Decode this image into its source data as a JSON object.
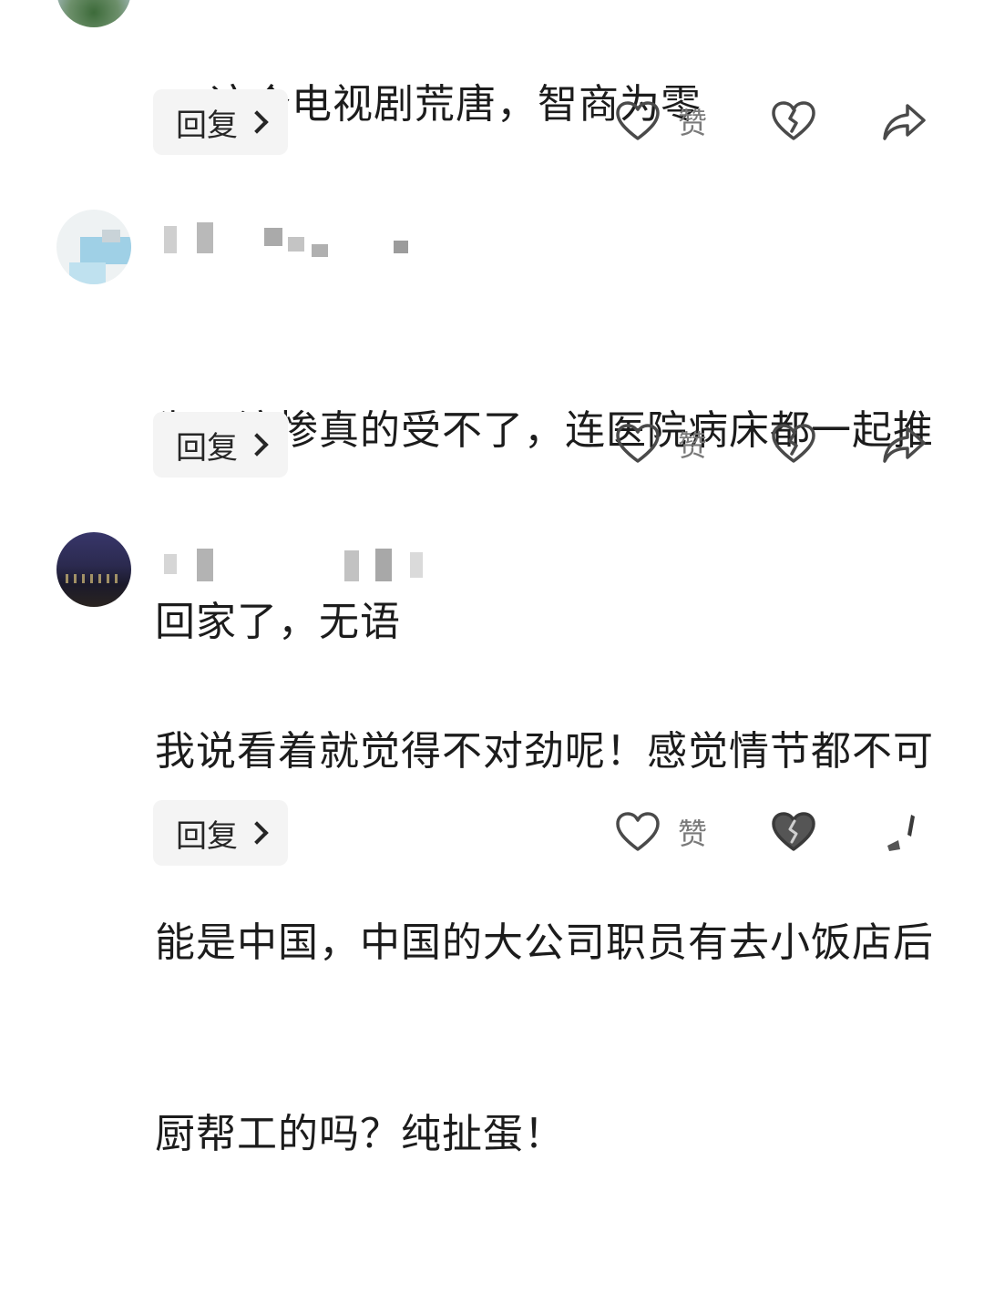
{
  "comments": [
    {
      "text_lines": [
        "这个电视剧荒唐，智商为零"
      ],
      "reply_label": "回复",
      "like_label": "赞"
    },
    {
      "text_lines": [
        "为了演惨真的受不了，连医院病床都一起推",
        "回家了，无语"
      ],
      "reply_label": "回复",
      "like_label": "赞"
    },
    {
      "text_lines": [
        "我说看着就觉得不对劲呢！感觉情节都不可",
        "能是中国，中国的大公司职员有去小饭店后",
        "厨帮工的吗？纯扯蛋！"
      ],
      "reply_label": "回复",
      "like_label": "赞"
    }
  ],
  "icons": {
    "like": "heart-outline-icon",
    "dislike": "broken-heart-icon",
    "share": "share-arrow-icon",
    "reply_chevron": "chevron-right-icon"
  },
  "colors": {
    "text": "#1c1c1c",
    "muted": "#7a7a7a",
    "reply_bg": "#f4f4f4",
    "icon": "#4a4a4a"
  }
}
